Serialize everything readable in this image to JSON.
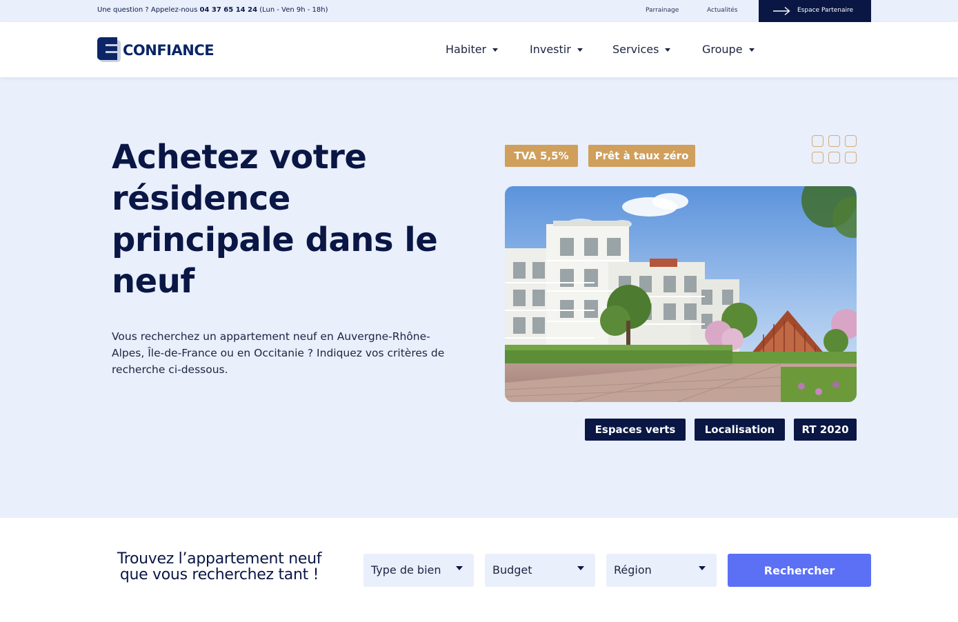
{
  "topbar": {
    "question_prefix": "Une question ? Appelez-nous ",
    "phone": "04 37 65 14 24",
    "hours": " (Lun - Ven 9h - 18h)",
    "links": [
      "Parrainage",
      "Actualités"
    ],
    "partner_label": "Espace Partenaire"
  },
  "header": {
    "logo_text": "CONFIANCE",
    "nav": [
      {
        "label": "Habiter"
      },
      {
        "label": "Investir"
      },
      {
        "label": "Services"
      },
      {
        "label": "Groupe"
      }
    ]
  },
  "hero": {
    "title": "Achetez votre résidence principale dans le neuf",
    "description": "Vous recherchez un appartement neuf en Auvergne-Rhône-Alpes, Île-de-France ou en Occitanie ? Indiquez vos critères de recherche ci-dessous.",
    "top_tags": [
      "TVA 5,5%",
      "Prêt à taux zéro"
    ],
    "bottom_tags": [
      "Espaces verts",
      "Localisation",
      "RT 2020"
    ]
  },
  "search": {
    "title": "Trouvez l’appartement neuf que vous recherchez tant !",
    "selects": [
      {
        "selected": "Type de bien"
      },
      {
        "selected": "Budget"
      },
      {
        "selected": "Région"
      }
    ],
    "button_label": "Rechercher"
  },
  "colors": {
    "navy": "#0a1745",
    "hero_bg": "#e9effb",
    "gold": "#d09f5b",
    "button": "#5b70f5"
  }
}
